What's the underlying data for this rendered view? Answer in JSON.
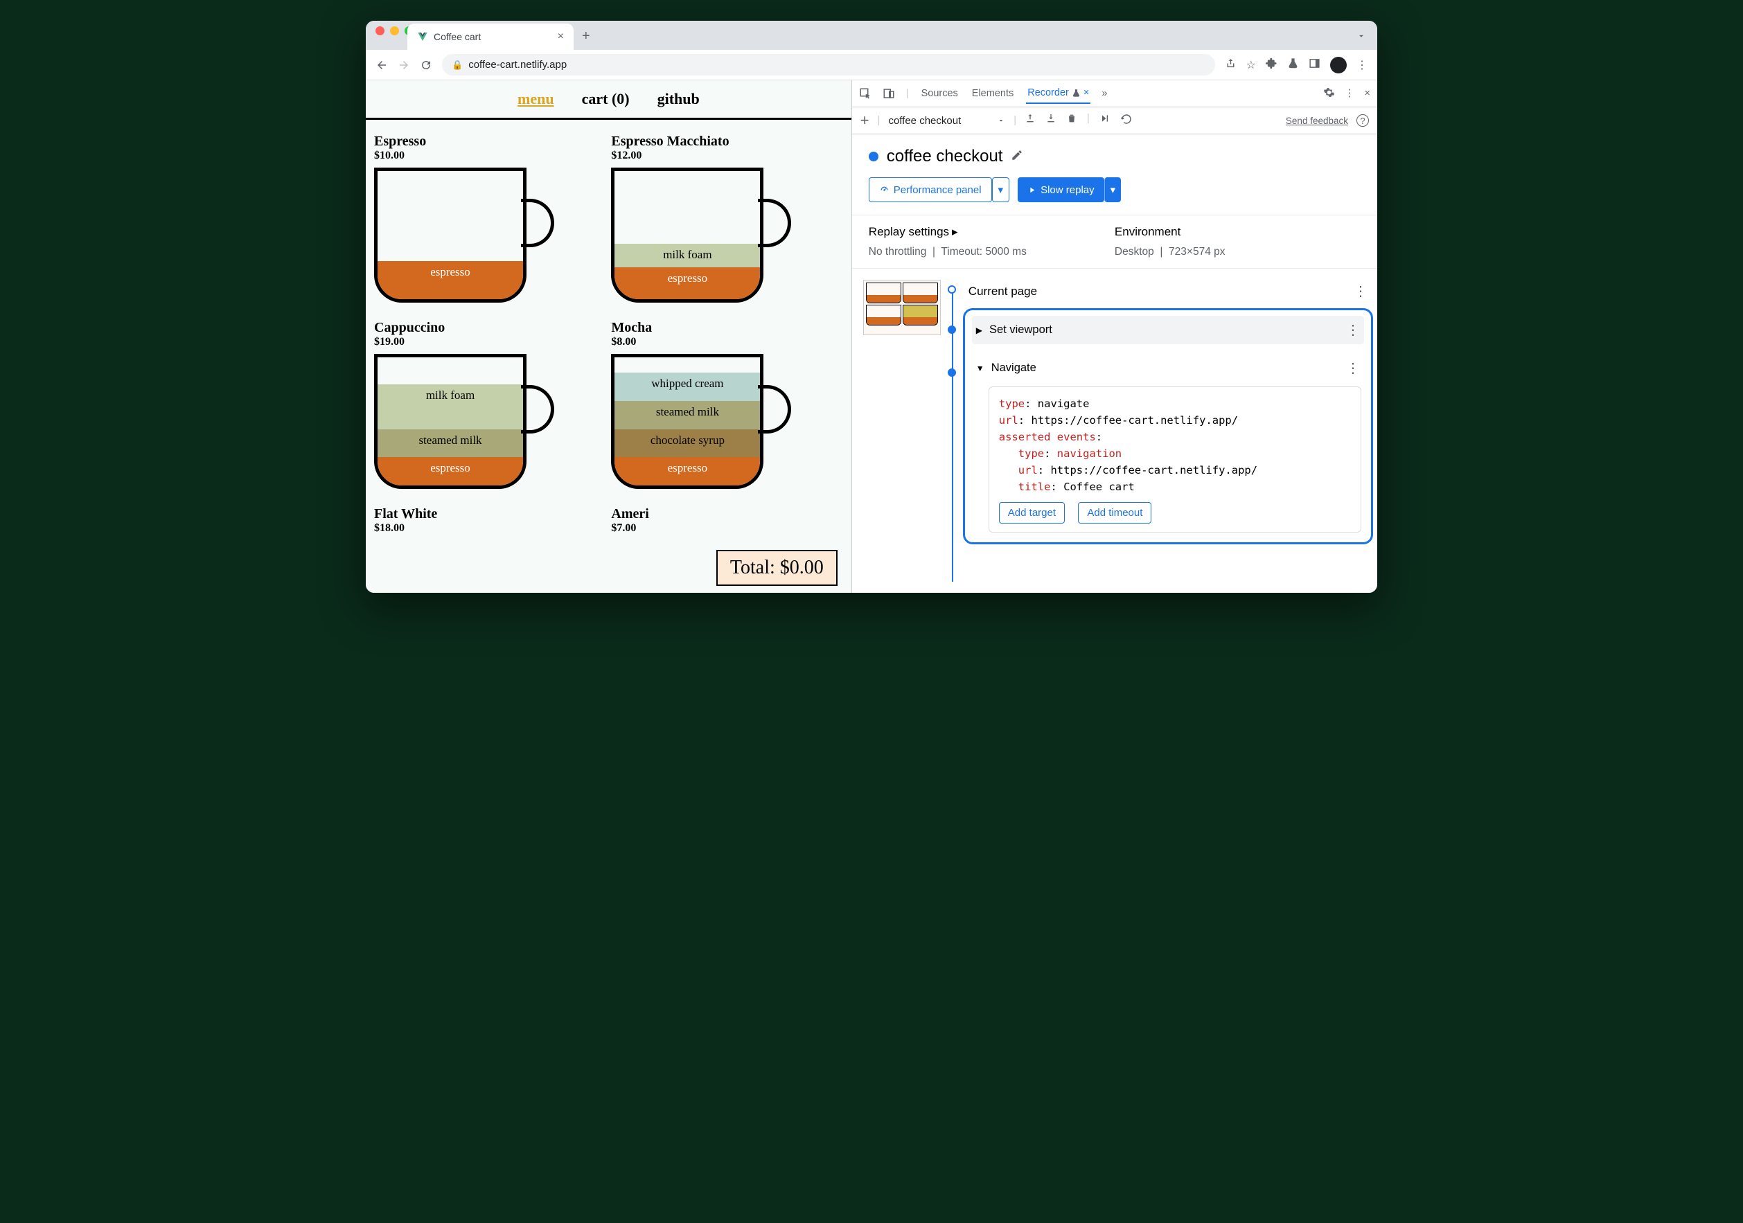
{
  "browser": {
    "tab_title": "Coffee cart",
    "url": "coffee-cart.netlify.app"
  },
  "site": {
    "nav": {
      "menu": "menu",
      "cart": "cart (0)",
      "github": "github"
    },
    "products": [
      {
        "name": "Espresso",
        "price": "$10.00"
      },
      {
        "name": "Espresso Macchiato",
        "price": "$12.00"
      },
      {
        "name": "Cappuccino",
        "price": "$19.00"
      },
      {
        "name": "Mocha",
        "price": "$8.00"
      },
      {
        "name": "Flat White",
        "price": "$18.00"
      },
      {
        "name": "Ameri",
        "price": "$7.00"
      }
    ],
    "layers": {
      "espresso": "espresso",
      "milkfoam": "milk foam",
      "steamed": "steamed milk",
      "whipped": "whipped cream",
      "choc": "chocolate syrup"
    },
    "total": "Total: $0.00"
  },
  "devtools": {
    "tabs": {
      "sources": "Sources",
      "elements": "Elements",
      "recorder": "Recorder"
    },
    "toolbar": {
      "recording_name": "coffee checkout",
      "feedback": "Send feedback"
    },
    "recording": {
      "title": "coffee checkout",
      "perf_btn": "Performance panel",
      "replay_btn": "Slow replay"
    },
    "settings": {
      "replay_heading": "Replay settings",
      "throttling": "No throttling",
      "timeout": "Timeout: 5000 ms",
      "env_heading": "Environment",
      "device": "Desktop",
      "viewport": "723×574 px"
    },
    "steps": {
      "current_page": "Current page",
      "set_viewport": "Set viewport",
      "navigate": "Navigate",
      "details": {
        "type_k": "type",
        "type_v": "navigate",
        "url_k": "url",
        "url_v": "https://coffee-cart.netlify.app/",
        "asserted_k": "asserted events",
        "ev_type_k": "type",
        "ev_type_v": "navigation",
        "ev_url_k": "url",
        "ev_url_v": "https://coffee-cart.netlify.app/",
        "ev_title_k": "title",
        "ev_title_v": "Coffee cart"
      },
      "add_target": "Add target",
      "add_timeout": "Add timeout"
    }
  }
}
